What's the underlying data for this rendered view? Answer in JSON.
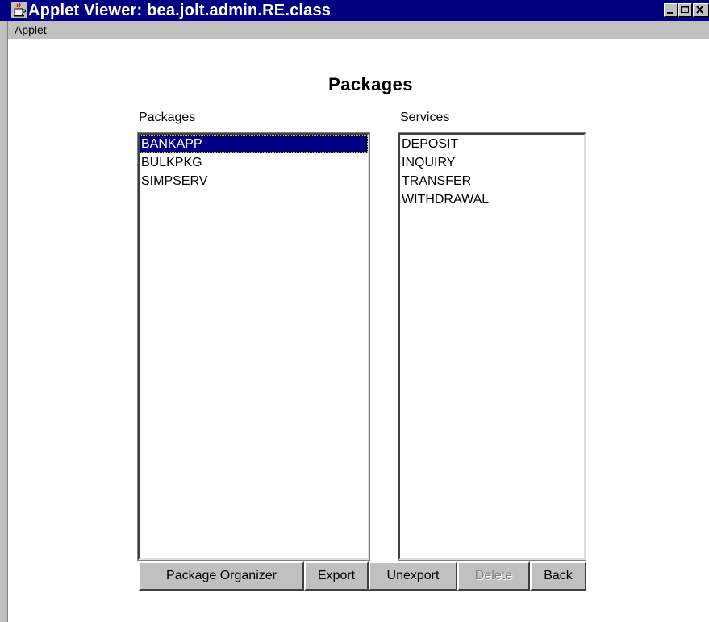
{
  "window": {
    "title": "Applet Viewer: bea.jolt.admin.RE.class",
    "icon": "java-cup-icon",
    "controls": [
      "minimize-icon",
      "maximize-icon",
      "close-icon"
    ]
  },
  "menubar": {
    "items": [
      "Applet"
    ]
  },
  "page": {
    "title": "Packages"
  },
  "packages": {
    "label": "Packages",
    "items": [
      "BANKAPP",
      "BULKPKG",
      "SIMPSERV"
    ],
    "selected": "BANKAPP"
  },
  "services": {
    "label": "Services",
    "items": [
      "DEPOSIT",
      "INQUIRY",
      "TRANSFER",
      "WITHDRAWAL"
    ]
  },
  "buttons": {
    "package_organizer": "Package Organizer",
    "export": "Export",
    "unexport": "Unexport",
    "delete": "Delete",
    "back": "Back"
  },
  "colors": {
    "titlebar": "#000080",
    "selection": "#000080",
    "button_face": "#c0c0c0"
  }
}
